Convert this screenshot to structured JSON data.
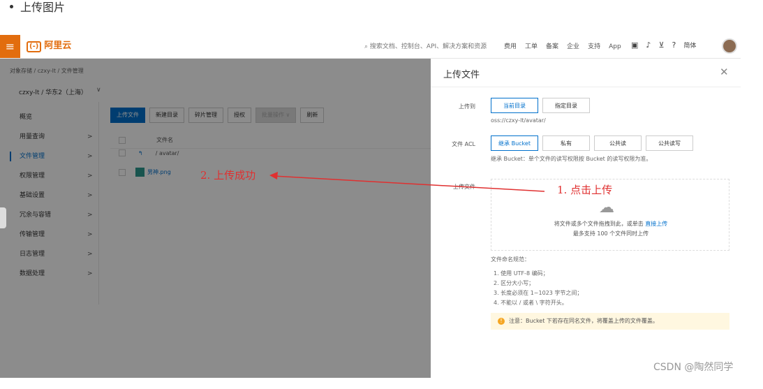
{
  "blog": {
    "bullet": "上传图片",
    "watermark": "CSDN @陶然同学"
  },
  "console": {
    "menu_icon": "hamburger-icon",
    "logo_mark": "(-)",
    "logo_text": "阿里云",
    "search_placeholder": "搜索文档、控制台、API、解决方案和资源",
    "nav": [
      "费用",
      "工单",
      "备案",
      "企业",
      "支持",
      "App"
    ],
    "lang": "简体",
    "breadcrumb": "对象存储 / czxy-lt / 文件管理",
    "bucket_select": "czxy-lt / 华东2（上海）",
    "sidebar": [
      "概览",
      "用量查询",
      "文件管理",
      "权限管理",
      "基础设置",
      "冗余与容错",
      "传输管理",
      "日志管理",
      "数据处理"
    ],
    "toolbar": {
      "upload": "上传文件",
      "new_dir": "新建目录",
      "fragments": "碎片管理",
      "auth": "授权",
      "batch": "批量操作",
      "refresh": "刷新"
    },
    "table": {
      "col_name": "文件名",
      "path_row": "/ avatar/",
      "file_name": "男神.png"
    }
  },
  "panel": {
    "title": "上传文件",
    "upload_to_label": "上传到",
    "upload_to_options": [
      "当前目录",
      "指定目录"
    ],
    "path": "oss://czxy-lt/avatar/",
    "acl_label": "文件 ACL",
    "acl_options": [
      "继承 Bucket",
      "私有",
      "公共读",
      "公共读写"
    ],
    "acl_hint": "继承 Bucket：单个文件的读写权限按 Bucket 的读写权限为准。",
    "file_label": "上传文件",
    "drop_text": "将文件或多个文件拖拽到此，或单击",
    "drop_link": "直接上传",
    "drop_limit": "最多支持 100 个文件同时上传",
    "rules_title": "文件命名规范：",
    "rules": [
      "1. 使用 UTF-8 编码；",
      "2. 区分大小写；",
      "3. 长度必须在 1~1023 字节之间；",
      "4. 不能以 / 或者 \\ 字符开头。"
    ],
    "warning": "注意：Bucket 下若存在同名文件，将覆盖上传的文件覆盖。"
  },
  "annotations": {
    "step1": "1. 点击上传",
    "step2": "2. 上传成功",
    "color": "#e03030"
  }
}
